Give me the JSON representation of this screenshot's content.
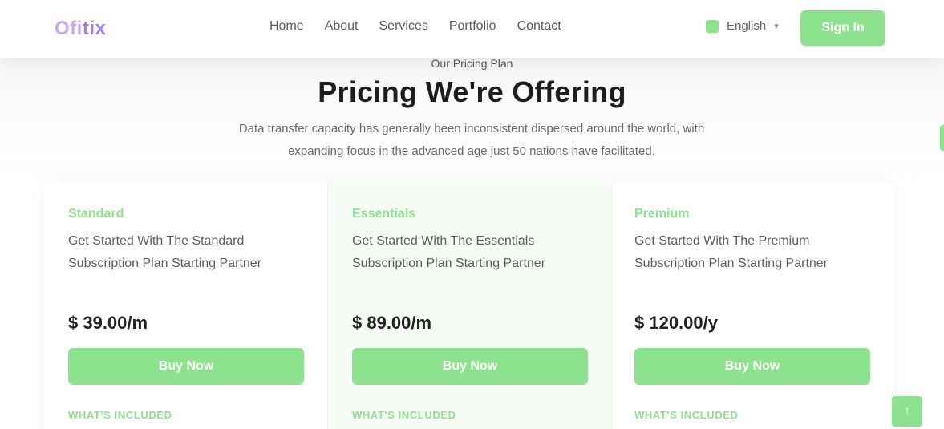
{
  "header": {
    "logo_part1": "Ofi",
    "logo_part2": "tix",
    "nav": [
      "Home",
      "About",
      "Services",
      "Portfolio",
      "Contact"
    ],
    "language": "English",
    "signin_label": "Sign In"
  },
  "section": {
    "eyebrow": "Our Pricing Plan",
    "title": "Pricing We're Offering",
    "subtitle": "Data transfer capacity has generally been inconsistent dispersed around the world, with expanding focus in the advanced age just 50 nations have facilitated."
  },
  "cards": [
    {
      "plan": "Standard",
      "desc": "Get Started With The Standard Subscription Plan Starting Partner",
      "price": "$ 39.00/m",
      "button": "Buy Now",
      "included": "WHAT'S INCLUDED"
    },
    {
      "plan": "Essentials",
      "desc": "Get Started With The Essentials Subscription Plan Starting Partner",
      "price": "$ 89.00/m",
      "button": "Buy Now",
      "included": "WHAT'S INCLUDED"
    },
    {
      "plan": "Premium",
      "desc": "Get Started With The Premium Subscription Plan Starting Partner",
      "price": "$ 120.00/y",
      "button": "Buy Now",
      "included": "WHAT'S INCLUDED"
    }
  ],
  "colors": {
    "accent": "#8de38d",
    "logo_light": "#c8a6f0",
    "logo_dark": "#a07cf0"
  },
  "icons": {
    "flag": "flag-icon",
    "language_chevron": "chevron-down-icon",
    "scroll_top": "arrow-up-icon"
  }
}
